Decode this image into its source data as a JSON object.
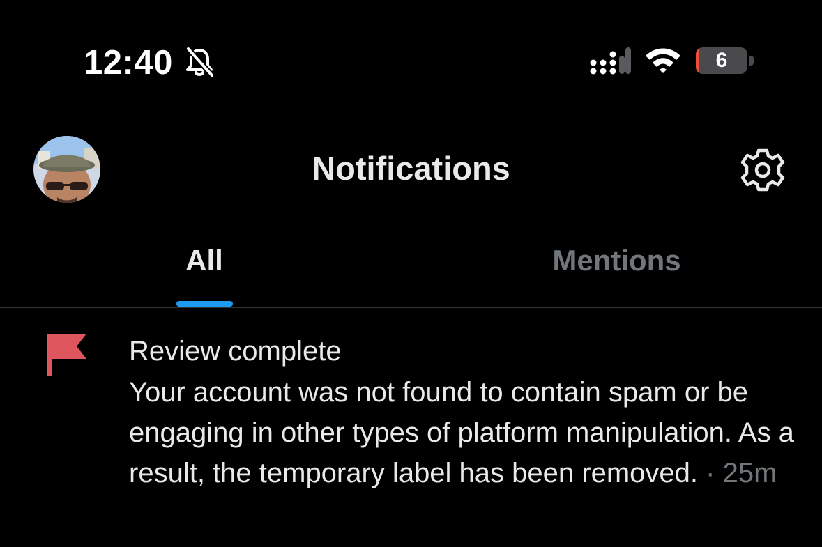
{
  "status_bar": {
    "time": "12:40",
    "battery_percent": 6,
    "battery_label": "6",
    "silent_mode_icon": "bell-slash-icon",
    "signal_icon": "cellular-signal-icon",
    "wifi_icon": "wifi-icon"
  },
  "header": {
    "title": "Notifications",
    "settings_icon": "gear-icon",
    "avatar_icon": "user-avatar"
  },
  "tabs": [
    {
      "label": "All",
      "selected": true
    },
    {
      "label": "Mentions",
      "selected": false
    }
  ],
  "notifications": [
    {
      "icon": "flag-icon",
      "title": "Review complete",
      "body": "Your account was not found to contain spam or be engaging in other types of platform manipulation. As a result, the temporary label has been removed.",
      "separator": "·",
      "time": "25m"
    }
  ],
  "colors": {
    "background": "#000000",
    "text_primary": "#e7e9ea",
    "text_secondary": "#71767b",
    "accent": "#1d9bf0",
    "flag": "#e0565f",
    "battery_low": "#eb4d3d"
  }
}
